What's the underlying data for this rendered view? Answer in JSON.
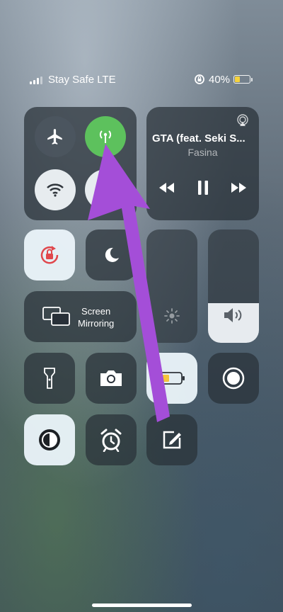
{
  "status_bar": {
    "carrier": "Stay Safe LTE",
    "battery_percent": "40%",
    "battery_level": 0.4,
    "battery_color": "#f5d23c"
  },
  "connectivity": {
    "airplane_mode": false,
    "cellular_data": true,
    "wifi": true,
    "bluetooth": true,
    "active_color": "#5dc15d"
  },
  "now_playing": {
    "title": "GTA (feat. Seki S...",
    "artist": "Fasina"
  },
  "screen_mirroring": {
    "label_line1": "Screen",
    "label_line2": "Mirroring"
  },
  "sliders": {
    "brightness_level": 0.0,
    "volume_level": 0.35
  },
  "tiles": [
    {
      "name": "orientation-lock",
      "active": true
    },
    {
      "name": "do-not-disturb",
      "active": false
    },
    {
      "name": "flashlight",
      "active": false
    },
    {
      "name": "camera",
      "active": false
    },
    {
      "name": "low-power-mode",
      "active": true
    },
    {
      "name": "screen-recording",
      "active": false
    },
    {
      "name": "dark-mode",
      "active": true
    },
    {
      "name": "alarm",
      "active": false
    },
    {
      "name": "notes",
      "active": false
    }
  ],
  "annotation": {
    "arrow_color": "#a44ed8"
  }
}
